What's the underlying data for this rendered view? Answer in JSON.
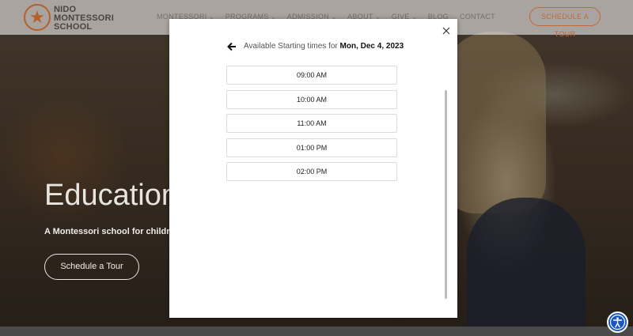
{
  "site": {
    "logo_lines": [
      "NIDO",
      "MONTESSORI",
      "SCHOOL"
    ],
    "nav": [
      "MONTESSORI",
      "PROGRAMS",
      "ADMISSION",
      "ABOUT",
      "GIVE",
      "BLOG",
      "CONTACT"
    ],
    "nav_has_caret": [
      true,
      true,
      true,
      true,
      true,
      false,
      false
    ],
    "schedule_button": "SCHEDULE A TOUR",
    "hero_title": "Education",
    "hero_subtitle": "A Montessori school for children",
    "hero_button": "Schedule a Tour"
  },
  "modal": {
    "header_prefix": "Available Starting times for",
    "header_date": "Mon, Dec 4, 2023",
    "time_slots": [
      "09:00 AM",
      "10:00 AM",
      "11:00 AM",
      "01:00 PM",
      "02:00 PM"
    ]
  },
  "icons": {
    "close": "close-icon",
    "back": "arrow-left-icon",
    "accessibility": "accessibility-icon",
    "logo": "star-icon"
  },
  "colors": {
    "brand": "#c06a3a",
    "accessibility": "#1a56c4"
  }
}
